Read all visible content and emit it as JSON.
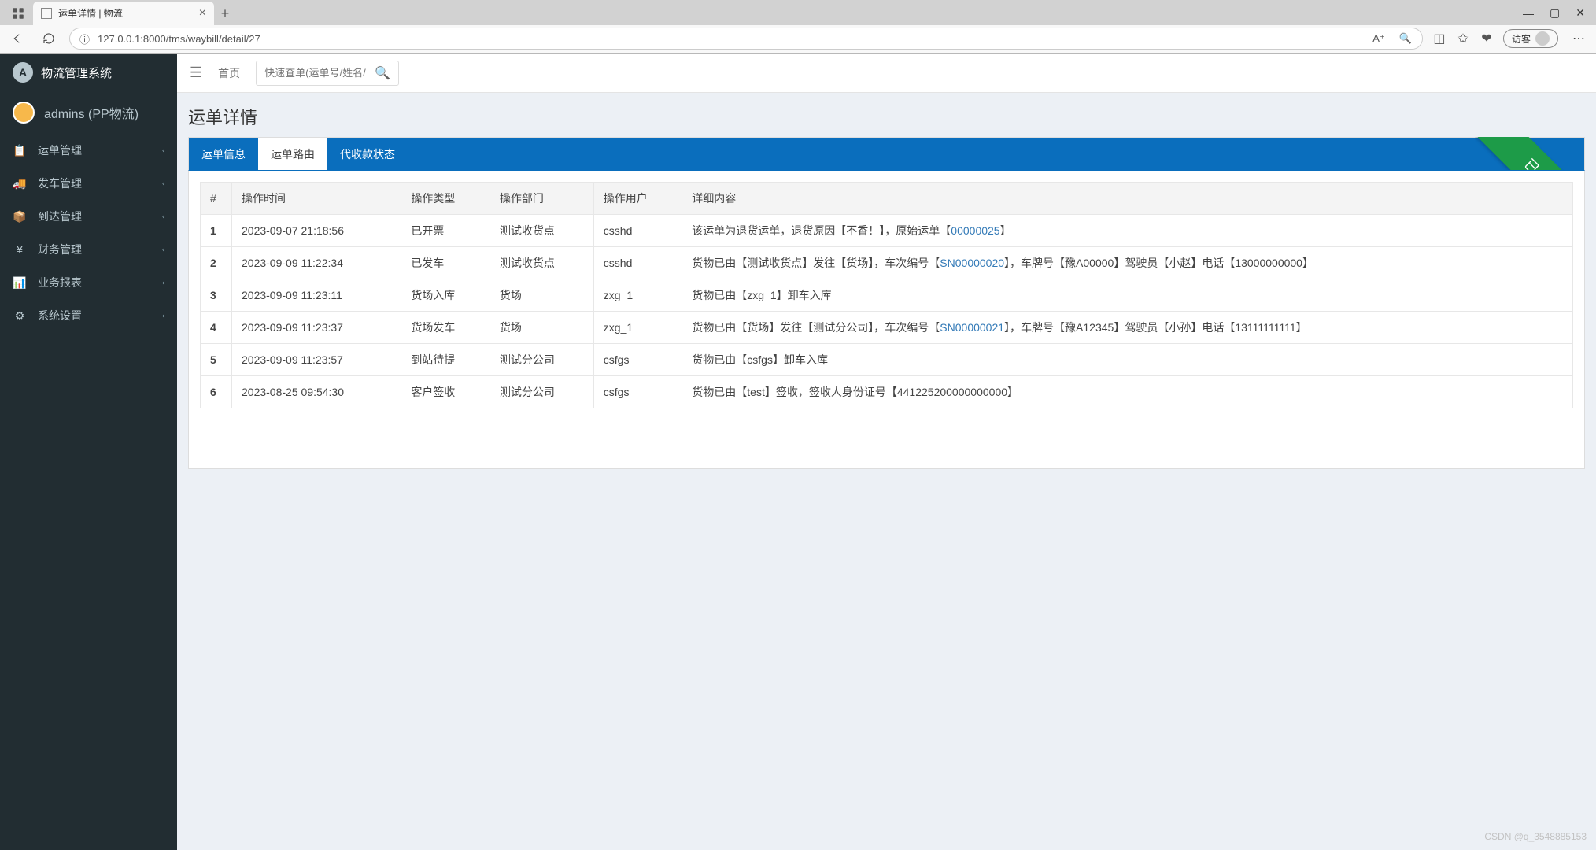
{
  "browser": {
    "tab_title": "运单详情 | 物流",
    "url": "127.0.0.1:8000/tms/waybill/detail/27",
    "guest_label": "访客"
  },
  "sidebar": {
    "logo_letter": "A",
    "app_name": "物流管理系统",
    "user_label": "admins (PP物流)",
    "items": [
      {
        "label": "运单管理",
        "icon": "📋"
      },
      {
        "label": "发车管理",
        "icon": "🚚"
      },
      {
        "label": "到达管理",
        "icon": "📦"
      },
      {
        "label": "财务管理",
        "icon": "¥"
      },
      {
        "label": "业务报表",
        "icon": "📊"
      },
      {
        "label": "系统设置",
        "icon": "⚙"
      }
    ]
  },
  "topbar": {
    "home_label": "首页",
    "search_placeholder": "快速查单(运单号/姓名/电"
  },
  "page": {
    "title": "运单详情",
    "tabs": [
      {
        "label": "运单信息"
      },
      {
        "label": "运单路由"
      },
      {
        "label": "代收款状态"
      }
    ],
    "ribbon": "已签收"
  },
  "table": {
    "headers": [
      "#",
      "操作时间",
      "操作类型",
      "操作部门",
      "操作用户",
      "详细内容"
    ],
    "rows": [
      {
        "idx": "1",
        "time": "2023-09-07 21:18:56",
        "type": "已开票",
        "dept": "测试收货点",
        "user": "csshd",
        "detail_parts": [
          "该运单为退货运单，退货原因【不香！】，原始运单【",
          "00000025",
          "】"
        ]
      },
      {
        "idx": "2",
        "time": "2023-09-09 11:22:34",
        "type": "已发车",
        "dept": "测试收货点",
        "user": "csshd",
        "detail_parts": [
          "货物已由【测试收货点】发往【货场】，车次编号【",
          "SN00000020",
          "】，车牌号【豫A00000】驾驶员【小赵】电话【13000000000】"
        ]
      },
      {
        "idx": "3",
        "time": "2023-09-09 11:23:11",
        "type": "货场入库",
        "dept": "货场",
        "user": "zxg_1",
        "detail_parts": [
          "货物已由【zxg_1】卸车入库",
          "",
          ""
        ]
      },
      {
        "idx": "4",
        "time": "2023-09-09 11:23:37",
        "type": "货场发车",
        "dept": "货场",
        "user": "zxg_1",
        "detail_parts": [
          "货物已由【货场】发往【测试分公司】，车次编号【",
          "SN00000021",
          "】，车牌号【豫A12345】驾驶员【小孙】电话【13111111111】"
        ]
      },
      {
        "idx": "5",
        "time": "2023-09-09 11:23:57",
        "type": "到站待提",
        "dept": "测试分公司",
        "user": "csfgs",
        "detail_parts": [
          "货物已由【csfgs】卸车入库",
          "",
          ""
        ]
      },
      {
        "idx": "6",
        "time": "2023-08-25 09:54:30",
        "type": "客户签收",
        "dept": "测试分公司",
        "user": "csfgs",
        "detail_parts": [
          "货物已由【test】签收，签收人身份证号【441225200000000000】",
          "",
          ""
        ]
      }
    ]
  },
  "watermark": "CSDN @q_3548885153"
}
